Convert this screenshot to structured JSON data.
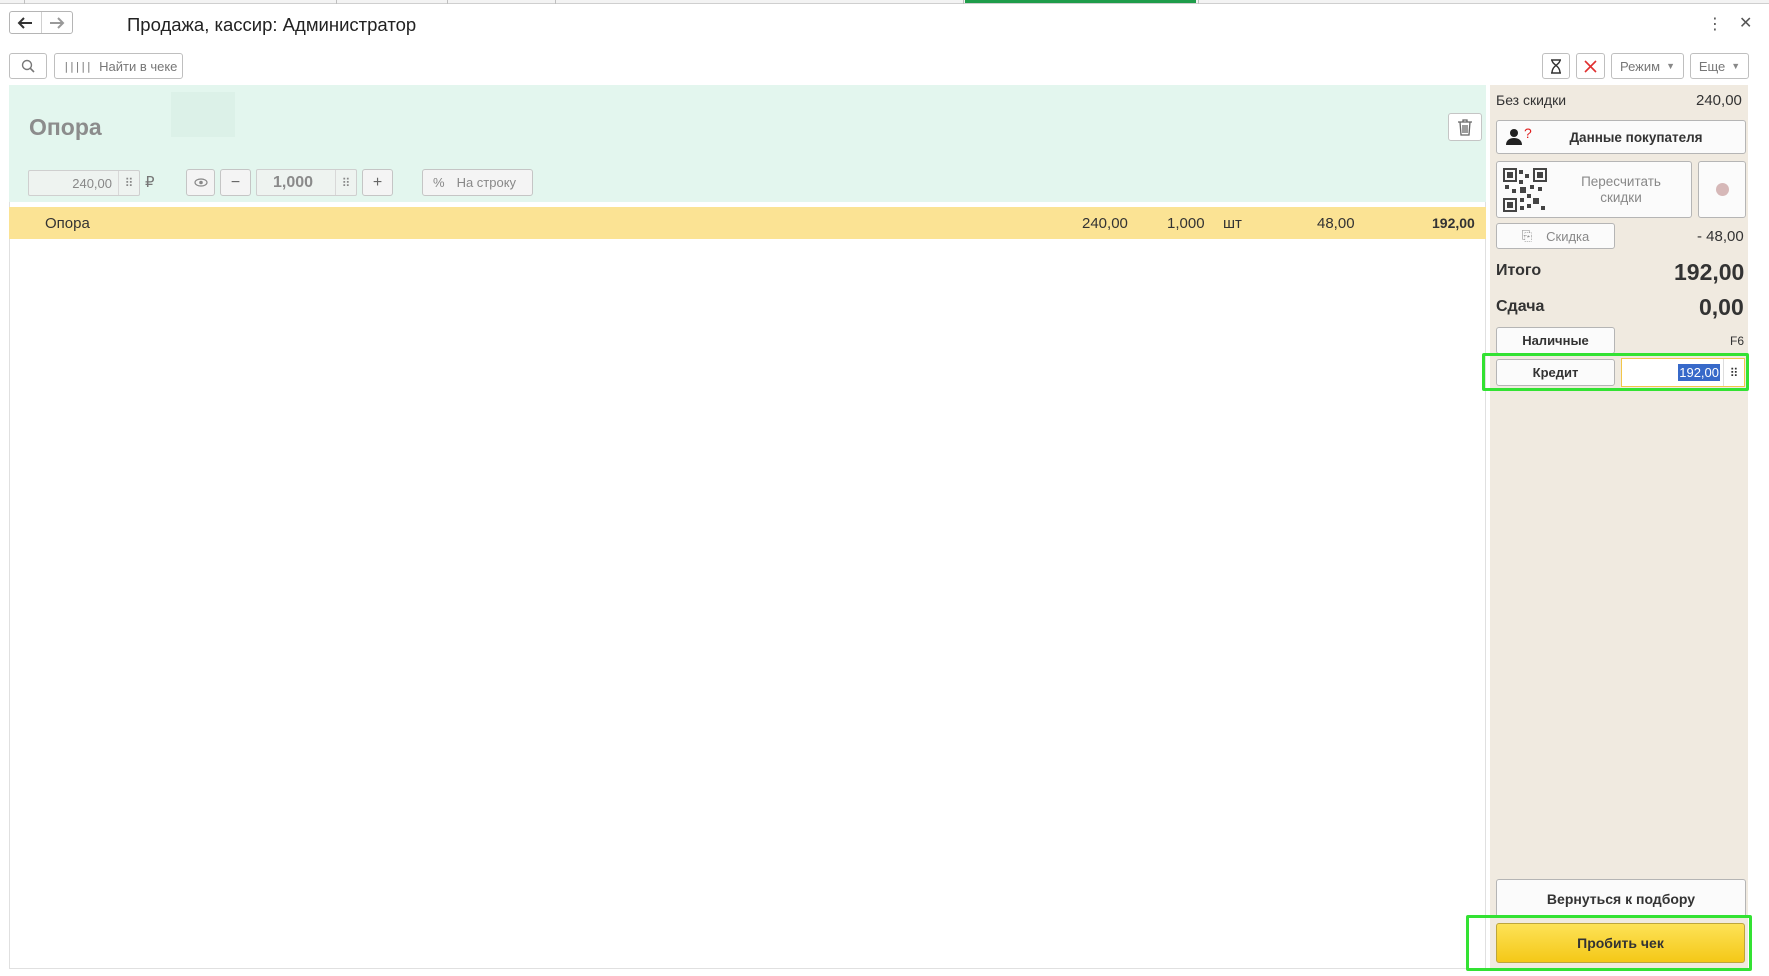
{
  "window": {
    "title": "Продажа, кассир: Администратор",
    "back_icon": "arrow-left-icon",
    "forward_icon": "arrow-right-icon",
    "more_icon": "kebab-icon",
    "close_icon": "close-icon"
  },
  "toolbar": {
    "search_icon": "search-icon",
    "find_in_receipt": "Найти в чеке",
    "mode_label": "Режим",
    "more_label": "Еще"
  },
  "product": {
    "name": "Опора",
    "price": "240,00",
    "currency": "₽",
    "quantity": "1,000",
    "discount_symbol": "%",
    "discount_per_line": "На строку"
  },
  "lines": [
    {
      "name": "Опора",
      "price": "240,00",
      "qty": "1,000",
      "unit": "шт",
      "discount": "48,00",
      "sum": "192,00"
    }
  ],
  "summary": {
    "no_discount_label": "Без скидки",
    "no_discount_value": "240,00",
    "customer_data": "Данные покупателя",
    "customer_mark": "?",
    "recalc_discounts": "Пересчитать скидки",
    "discount_label": "Скидка",
    "discount_value": "- 48,00",
    "total_label": "Итого",
    "total_value": "192,00",
    "change_label": "Сдача",
    "change_value": "0,00",
    "cash_label": "Наличные",
    "cash_hotkey": "F6",
    "credit_label": "Кредит",
    "credit_value": "192,00",
    "back_to_selection": "Вернуться к подбору",
    "print_receipt": "Пробить чек"
  },
  "colors": {
    "header_bg": "#e3f6ee",
    "selected_row": "#fbe394",
    "panel_bg": "#f0eae0",
    "highlight": "#33e233",
    "primary_button": "#f8d43a"
  }
}
